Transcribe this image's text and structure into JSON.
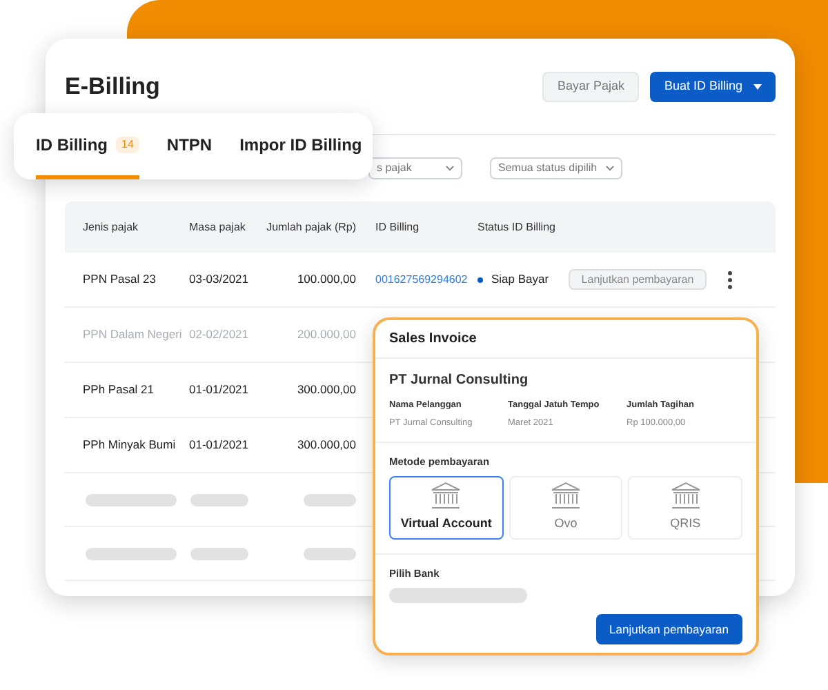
{
  "header": {
    "title": "E-Billing",
    "buttons": [
      {
        "label": "Bayar Pajak",
        "kind": "secondary"
      },
      {
        "label": "Buat ID Billing",
        "kind": "primary"
      }
    ]
  },
  "tabs": [
    {
      "label": "ID Billing",
      "count": "14",
      "selected": true
    },
    {
      "label": "NTPN",
      "selected": false
    },
    {
      "label": "Impor ID Billing",
      "selected": false
    }
  ],
  "filters": [
    {
      "value": "s pajak"
    },
    {
      "value": "Semua status dipilih"
    }
  ],
  "table": {
    "columns": [
      "Jenis pajak",
      "Masa pajak",
      "Jumlah pajak (Rp)",
      "ID Billing",
      "Status ID Billing"
    ],
    "rows": [
      {
        "kind": "data",
        "faded": false,
        "cells": [
          "PPN Pasal 23",
          "03-03/2021",
          "100.000,00"
        ],
        "id_billing": "001627569294602",
        "status": "Siap Bayar",
        "action": "Lanjutkan pembayaran"
      },
      {
        "kind": "data",
        "faded": true,
        "cells": [
          "PPN Dalam Negeri",
          "02-02/2021",
          "200.000,00"
        ]
      },
      {
        "kind": "data",
        "faded": false,
        "cells": [
          "PPh Pasal 21",
          "01-01/2021",
          "300.000,00"
        ]
      },
      {
        "kind": "data",
        "faded": false,
        "cells": [
          "PPh Minyak Bumi",
          "01-01/2021",
          "300.000,00"
        ]
      },
      {
        "kind": "skeleton"
      },
      {
        "kind": "skeleton"
      }
    ]
  },
  "invoice": {
    "title": "Sales Invoice",
    "company": "PT Jurnal Consulting",
    "fields": [
      {
        "label": "Nama Pelanggan",
        "value": "PT Jurnal Consulting"
      },
      {
        "label": "Tanggal Jatuh Tempo",
        "value": "Maret 2021"
      },
      {
        "label": "Jumlah Tagihan",
        "value": "Rp 100.000,00"
      }
    ],
    "method_label": "Metode pembayaran",
    "methods": [
      {
        "label": "Virtual Account",
        "selected": true
      },
      {
        "label": "Ovo",
        "selected": false
      },
      {
        "label": "QRIS",
        "selected": false
      }
    ],
    "bank_label": "Pilih Bank",
    "button": "Lanjutkan pembayaran"
  }
}
